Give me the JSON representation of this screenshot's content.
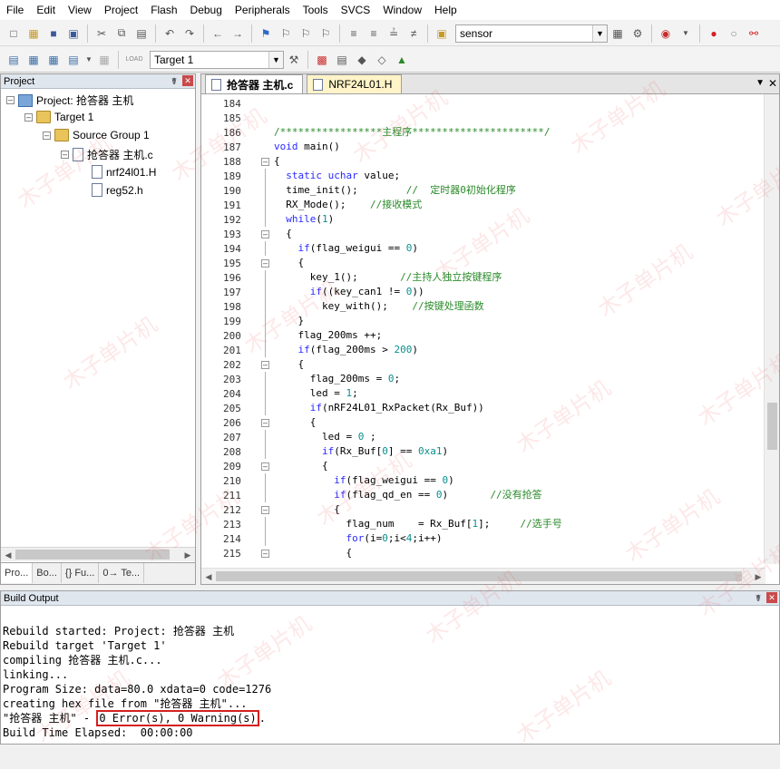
{
  "menu": [
    "File",
    "Edit",
    "View",
    "Project",
    "Flash",
    "Debug",
    "Peripherals",
    "Tools",
    "SVCS",
    "Window",
    "Help"
  ],
  "toolbar": {
    "search_combo": "sensor",
    "target_combo": "Target 1",
    "load_label": "LOAD"
  },
  "project_panel": {
    "title": "Project",
    "tree": {
      "project": "Project: 抢答器 主机",
      "target": "Target 1",
      "group": "Source Group 1",
      "file": "抢答器 主机.c",
      "includes": [
        "nrf24l01.H",
        "reg52.h"
      ]
    },
    "tabs": [
      "Pro...",
      "Bo...",
      "{} Fu...",
      "0→ Te..."
    ]
  },
  "editor": {
    "tabs": [
      {
        "label": "抢答器 主机.c",
        "active": true
      },
      {
        "label": "NRF24L01.H",
        "active": false
      }
    ],
    "lines": [
      {
        "n": "184",
        "text": ""
      },
      {
        "n": "185",
        "text": ""
      },
      {
        "n": "186",
        "text": "/*****************主程序**********************/"
      },
      {
        "n": "187",
        "text": "void main()"
      },
      {
        "n": "188",
        "text": "{"
      },
      {
        "n": "189",
        "text": "  static uchar value;"
      },
      {
        "n": "190",
        "text": "  time_init();        //  定时器0初始化程序"
      },
      {
        "n": "191",
        "text": "  RX_Mode();    //接收模式"
      },
      {
        "n": "192",
        "text": "  while(1)"
      },
      {
        "n": "193",
        "text": "  {"
      },
      {
        "n": "194",
        "text": "    if(flag_weigui == 0)"
      },
      {
        "n": "195",
        "text": "    {"
      },
      {
        "n": "196",
        "text": "      key_1();       //主持人独立按键程序"
      },
      {
        "n": "197",
        "text": "      if((key_can1 != 0))"
      },
      {
        "n": "198",
        "text": "        key_with();    //按键处理函数"
      },
      {
        "n": "199",
        "text": "    }"
      },
      {
        "n": "200",
        "text": "    flag_200ms ++;"
      },
      {
        "n": "201",
        "text": "    if(flag_200ms > 200)"
      },
      {
        "n": "202",
        "text": "    {"
      },
      {
        "n": "203",
        "text": "      flag_200ms = 0;"
      },
      {
        "n": "204",
        "text": "      led = 1;"
      },
      {
        "n": "205",
        "text": "      if(nRF24L01_RxPacket(Rx_Buf))"
      },
      {
        "n": "206",
        "text": "      {"
      },
      {
        "n": "207",
        "text": "        led = 0 ;"
      },
      {
        "n": "208",
        "text": "        if(Rx_Buf[0] == 0xa1)"
      },
      {
        "n": "209",
        "text": "        {"
      },
      {
        "n": "210",
        "text": "          if(flag_weigui == 0)"
      },
      {
        "n": "211",
        "text": "          if(flag_qd_en == 0)       //没有抢答"
      },
      {
        "n": "212",
        "text": "          {"
      },
      {
        "n": "213",
        "text": "            flag_num    = Rx_Buf[1];     //选手号"
      },
      {
        "n": "214",
        "text": "            for(i=0;i<4;i++)"
      },
      {
        "n": "215",
        "text": "            {"
      }
    ]
  },
  "build_output": {
    "title": "Build Output",
    "lines": [
      "Rebuild started: Project: 抢答器 主机",
      "Rebuild target 'Target 1'",
      "compiling 抢答器 主机.c...",
      "linking...",
      "Program Size: data=80.0 xdata=0 code=1276",
      "creating hex file from \"抢答器 主机\"...",
      "\"抢答器 主机\" - ",
      "Build Time Elapsed:  00:00:00"
    ],
    "result": "0 Error(s), 0 Warning(s)",
    "result_suffix": "."
  },
  "watermark": "木子单片机",
  "colors": {
    "keyword": "#2a2aff",
    "comment": "#2a8a2a",
    "number": "#0a8f8f",
    "error_box": "#d42020"
  }
}
